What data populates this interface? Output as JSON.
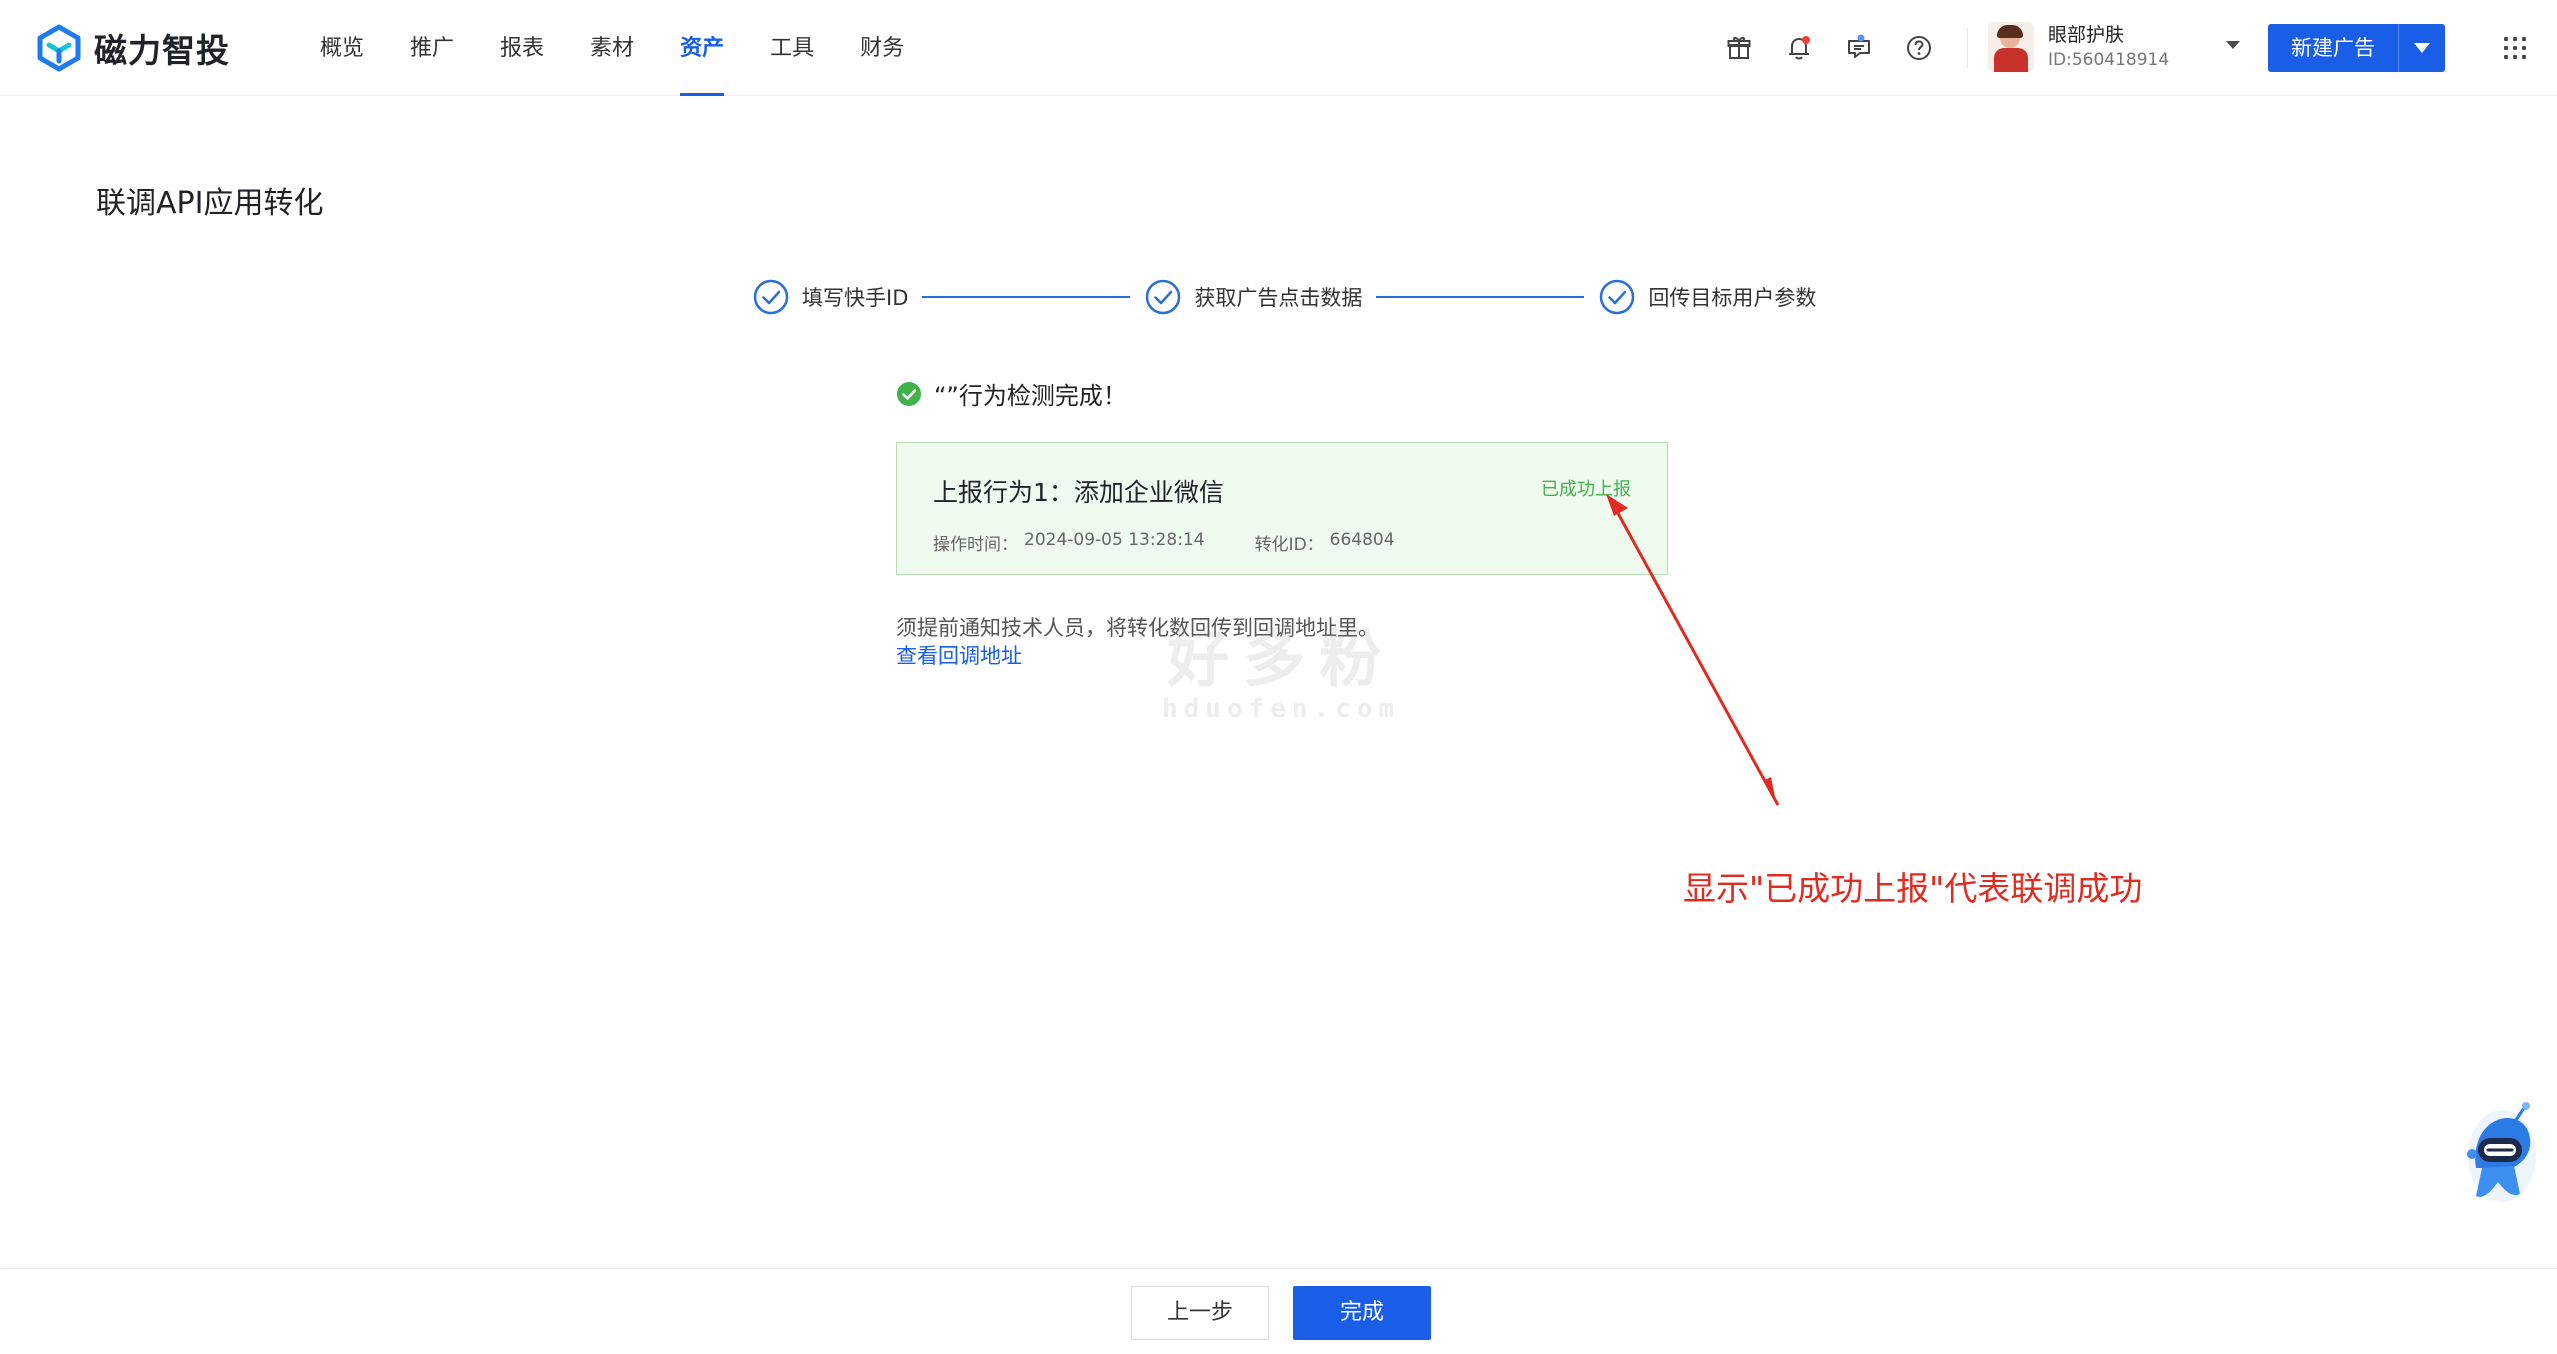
{
  "brand": {
    "name": "磁力智投"
  },
  "nav": {
    "items": [
      {
        "label": "概览",
        "active": false
      },
      {
        "label": "推广",
        "active": false
      },
      {
        "label": "报表",
        "active": false
      },
      {
        "label": "素材",
        "active": false
      },
      {
        "label": "资产",
        "active": true
      },
      {
        "label": "工具",
        "active": false
      },
      {
        "label": "财务",
        "active": false
      }
    ]
  },
  "header_icons": [
    "gift-icon",
    "bell-icon",
    "message-icon",
    "help-icon"
  ],
  "account": {
    "name": "眼部护肤",
    "id": "ID:560418914"
  },
  "new_ad": {
    "label": "新建广告"
  },
  "page": {
    "title": "联调API应用转化"
  },
  "steps": [
    {
      "label": "填写快手ID",
      "status": "done"
    },
    {
      "label": "获取广告点击数据",
      "status": "done"
    },
    {
      "label": "回传目标用户参数",
      "status": "done"
    }
  ],
  "result": {
    "text": "“”行为检测完成！"
  },
  "event": {
    "title": "上报行为1：添加企业微信",
    "status": "已成功上报",
    "time_label": "操作时间：",
    "time_value": "2024-09-05 13:28:14",
    "conv_label": "转化ID：",
    "conv_value": "664804"
  },
  "notice": {
    "text": "须提前通知技术人员，将转化数回传到回调地址里。",
    "link": "查看回调地址"
  },
  "watermark": {
    "big": "好多粉",
    "small": "hduofen.com"
  },
  "annotation": {
    "text": "显示\"已成功上报\"代表联调成功"
  },
  "footer": {
    "prev_label": "上一步",
    "done_label": "完成"
  },
  "colors": {
    "primary": "#1a5ee8",
    "success": "#3fb24a",
    "annotation": "#e02b20"
  }
}
